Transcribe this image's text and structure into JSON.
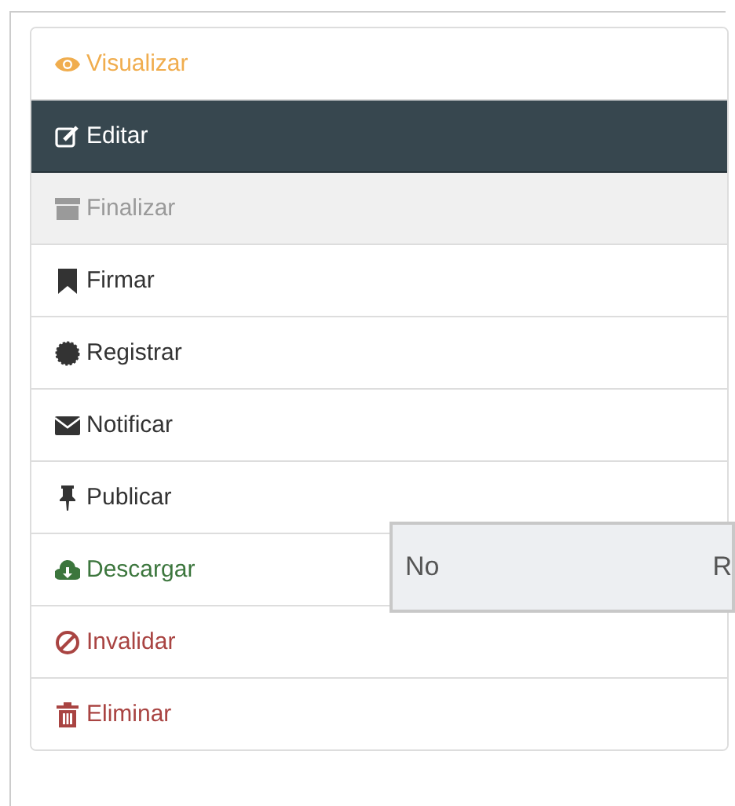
{
  "menu": {
    "items": [
      {
        "label": "Visualizar",
        "kind": "eye",
        "color": "#f0ad4e",
        "selected": false,
        "disabled": false
      },
      {
        "label": "Editar",
        "kind": "edit",
        "color": "#ffffff",
        "selected": true,
        "disabled": false
      },
      {
        "label": "Finalizar",
        "kind": "archive",
        "color": "#9a9a9a",
        "selected": false,
        "disabled": true
      },
      {
        "label": "Firmar",
        "kind": "bookmark",
        "color": "#333333",
        "selected": false,
        "disabled": false
      },
      {
        "label": "Registrar",
        "kind": "seal",
        "color": "#333333",
        "selected": false,
        "disabled": false
      },
      {
        "label": "Notificar",
        "kind": "envelope",
        "color": "#333333",
        "selected": false,
        "disabled": false
      },
      {
        "label": "Publicar",
        "kind": "pin",
        "color": "#333333",
        "selected": false,
        "disabled": false
      },
      {
        "label": "Descargar",
        "kind": "cloud",
        "color": "#3c763d",
        "selected": false,
        "disabled": false
      },
      {
        "label": "Invalidar",
        "kind": "ban",
        "color": "#a94442",
        "selected": false,
        "disabled": false
      },
      {
        "label": "Eliminar",
        "kind": "trash",
        "color": "#a94442",
        "selected": false,
        "disabled": false
      }
    ]
  },
  "popup": {
    "cells": [
      "No",
      "R"
    ]
  }
}
